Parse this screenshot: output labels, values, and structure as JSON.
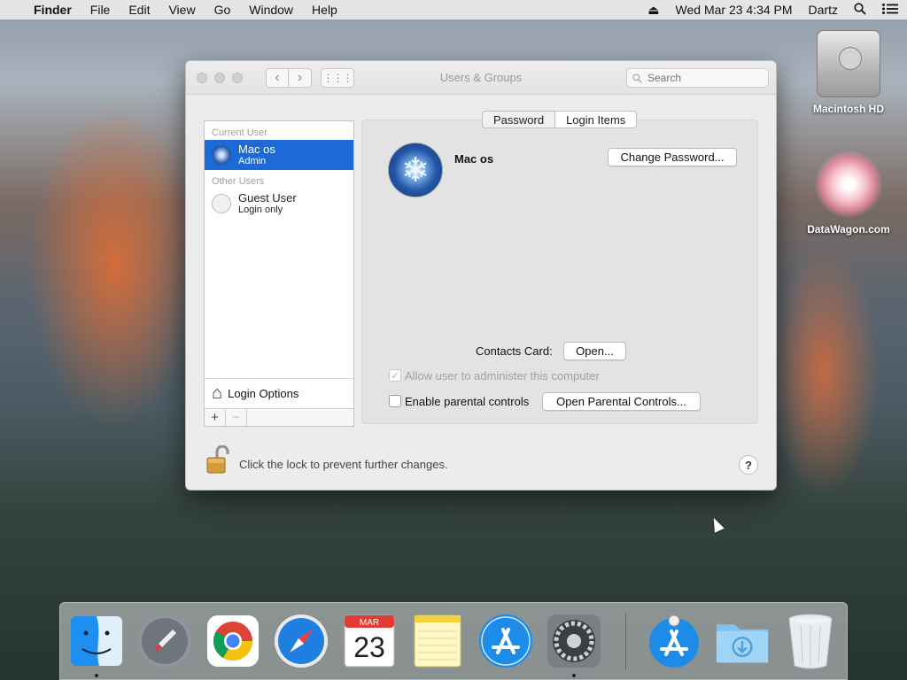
{
  "menubar": {
    "app": "Finder",
    "items": [
      "File",
      "Edit",
      "View",
      "Go",
      "Window",
      "Help"
    ],
    "clock": "Wed Mar 23  4:34 PM",
    "user": "Dartz"
  },
  "window": {
    "title": "Users & Groups",
    "search_placeholder": "Search",
    "sidebar": {
      "current_header": "Current User",
      "current": {
        "name": "Mac os",
        "role": "Admin"
      },
      "other_header": "Other Users",
      "guest": {
        "name": "Guest User",
        "role": "Login only"
      },
      "login_options": "Login Options"
    },
    "tabs": [
      "Password",
      "Login Items"
    ],
    "user_name": "Mac os",
    "change_password": "Change Password...",
    "contacts_label": "Contacts Card:",
    "open_button": "Open...",
    "allow_admin_label": "Allow user to administer this computer",
    "parental_label": "Enable parental controls",
    "parental_button": "Open Parental Controls...",
    "lock_message": "Click the lock to prevent further changes.",
    "help_label": "?"
  },
  "desktop": {
    "icons": [
      {
        "label": "Macintosh HD"
      },
      {
        "label": "DataWagon.com"
      }
    ]
  },
  "dock": {
    "calendar_month": "MAR",
    "calendar_day": "23"
  }
}
